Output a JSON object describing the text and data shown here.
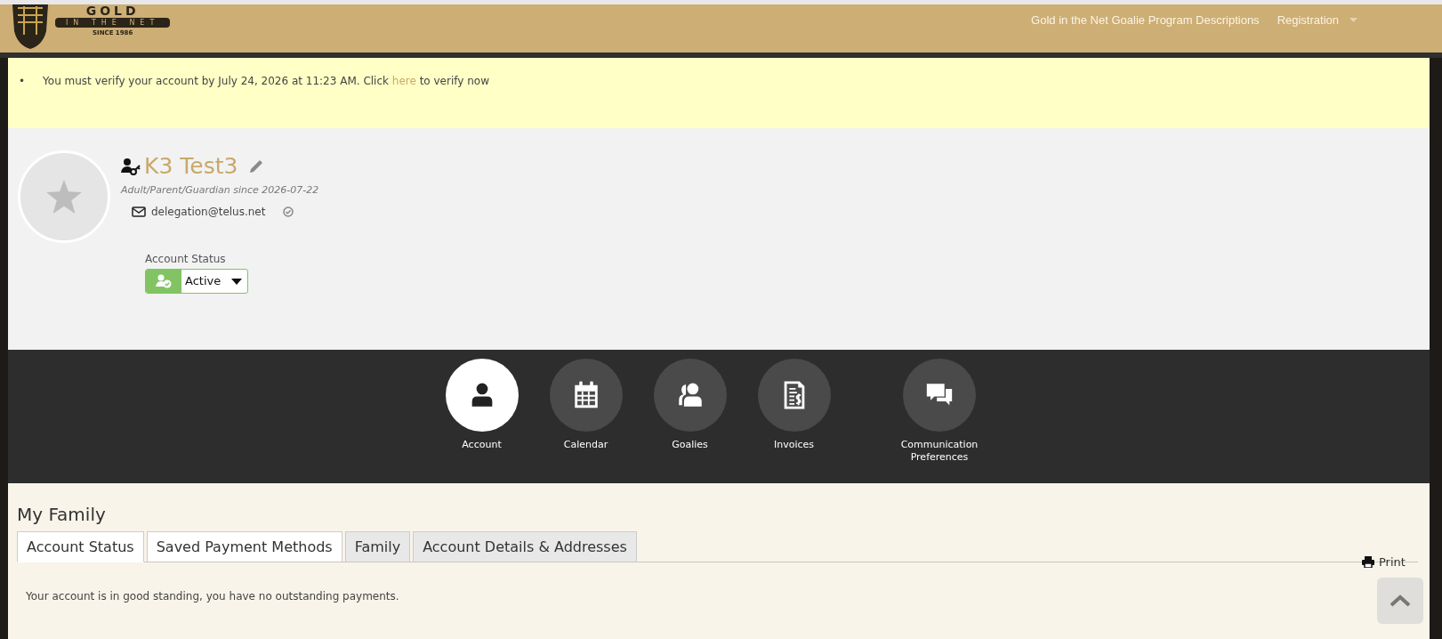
{
  "logo": {
    "title": "GOLD",
    "subtitle": "IN THE NET",
    "since": "SINCE 1986"
  },
  "top_nav": [
    {
      "label": "Gold in the Net Goalie Program Descriptions",
      "has_dropdown": false
    },
    {
      "label": "Registration",
      "has_dropdown": true
    }
  ],
  "notice": {
    "bullet": "•",
    "before": "You must verify your account by July 24, 2026 at 11:23 AM. Click",
    "link": "here",
    "after": "to verify now"
  },
  "profile": {
    "name": "K3 Test3",
    "role_since": "Adult/Parent/Guardian since 2026-07-22",
    "email": "delegation@telus.net",
    "email_verified": true,
    "status_label": "Account Status",
    "status": "Active"
  },
  "sections": [
    {
      "label": "Account",
      "kind": "person",
      "selected": true
    },
    {
      "label": "Calendar",
      "kind": "calendar",
      "selected": false
    },
    {
      "label": "Goalies",
      "kind": "people",
      "selected": false
    },
    {
      "label": "Invoices",
      "kind": "invoice",
      "selected": false
    },
    {
      "label": "Communication Preferences",
      "kind": "chat",
      "selected": false
    }
  ],
  "family": {
    "title": "My Family",
    "tabs": [
      {
        "label": "Account Status",
        "selected": true,
        "kind": "plain"
      },
      {
        "label": "Saved Payment Methods",
        "selected": false,
        "kind": "plain"
      },
      {
        "label": "Family",
        "selected": false,
        "kind": "shaded"
      },
      {
        "label": "Account Details & Addresses",
        "selected": false,
        "kind": "shaded"
      }
    ],
    "print": "Print",
    "message": "Your account is in good standing, you have no outstanding payments."
  }
}
